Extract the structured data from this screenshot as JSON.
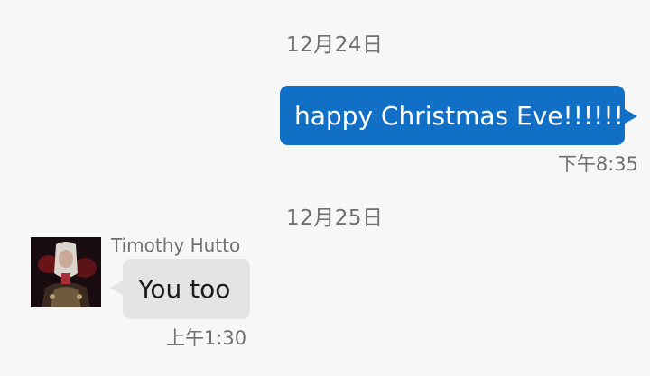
{
  "conversation": {
    "date_separators": [
      "12月24日",
      "12月25日"
    ],
    "messages": [
      {
        "direction": "outgoing",
        "text": "happy Christmas Eve!!!!!!",
        "time": "下午8:35"
      },
      {
        "direction": "incoming",
        "sender": "Timothy Hutto",
        "text": "You too",
        "time": "上午1:30",
        "avatar_icon": "avatar-photo"
      }
    ]
  },
  "colors": {
    "background": "#f7f7f7",
    "outgoing_bubble": "#1170c6",
    "incoming_bubble": "#e4e4e4",
    "meta_text": "#707070"
  }
}
